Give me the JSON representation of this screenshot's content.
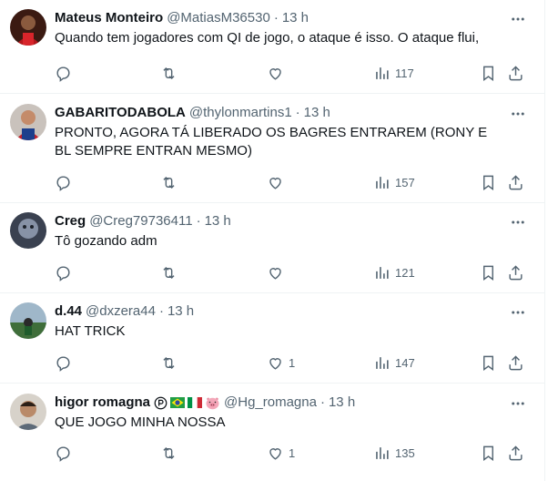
{
  "tweets": [
    {
      "name": "Mateus Monteiro",
      "handle": "@MatiasM36530",
      "sep": "·",
      "time": "13 h",
      "text": "Quando tem jogadores com QI de jogo, o ataque é isso. O ataque flui,",
      "likes": "",
      "views": "117"
    },
    {
      "name": "GABARITODABOLA",
      "handle": "@thylonmartins1",
      "sep": "·",
      "time": "13 h",
      "text": "PRONTO, AGORA TÁ LIBERADO OS BAGRES ENTRAREM (RONY E BL SEMPRE ENTRAN MESMO)",
      "likes": "",
      "views": "157"
    },
    {
      "name": "Creg",
      "handle": "@Creg79736411",
      "sep": "·",
      "time": "13 h",
      "text": "Tô gozando adm",
      "likes": "",
      "views": "121"
    },
    {
      "name": "d.44",
      "handle": "@dxzera44",
      "sep": "·",
      "time": "13 h",
      "text": "HAT TRICK",
      "likes": "1",
      "views": "147"
    },
    {
      "name": "higor romagna",
      "handle": "@Hg_romagna",
      "sep": "·",
      "time": "13 h",
      "text": "QUE JOGO MINHA NOSSA",
      "likes": "1",
      "views": "135",
      "name_badges": [
        "p-circle-icon",
        "brazil-flag-icon",
        "italy-flag-icon",
        "pig-emoji-icon"
      ]
    }
  ],
  "colors": {
    "text": "#0f1419",
    "secondary": "#536471",
    "divider": "#eff3f4"
  }
}
